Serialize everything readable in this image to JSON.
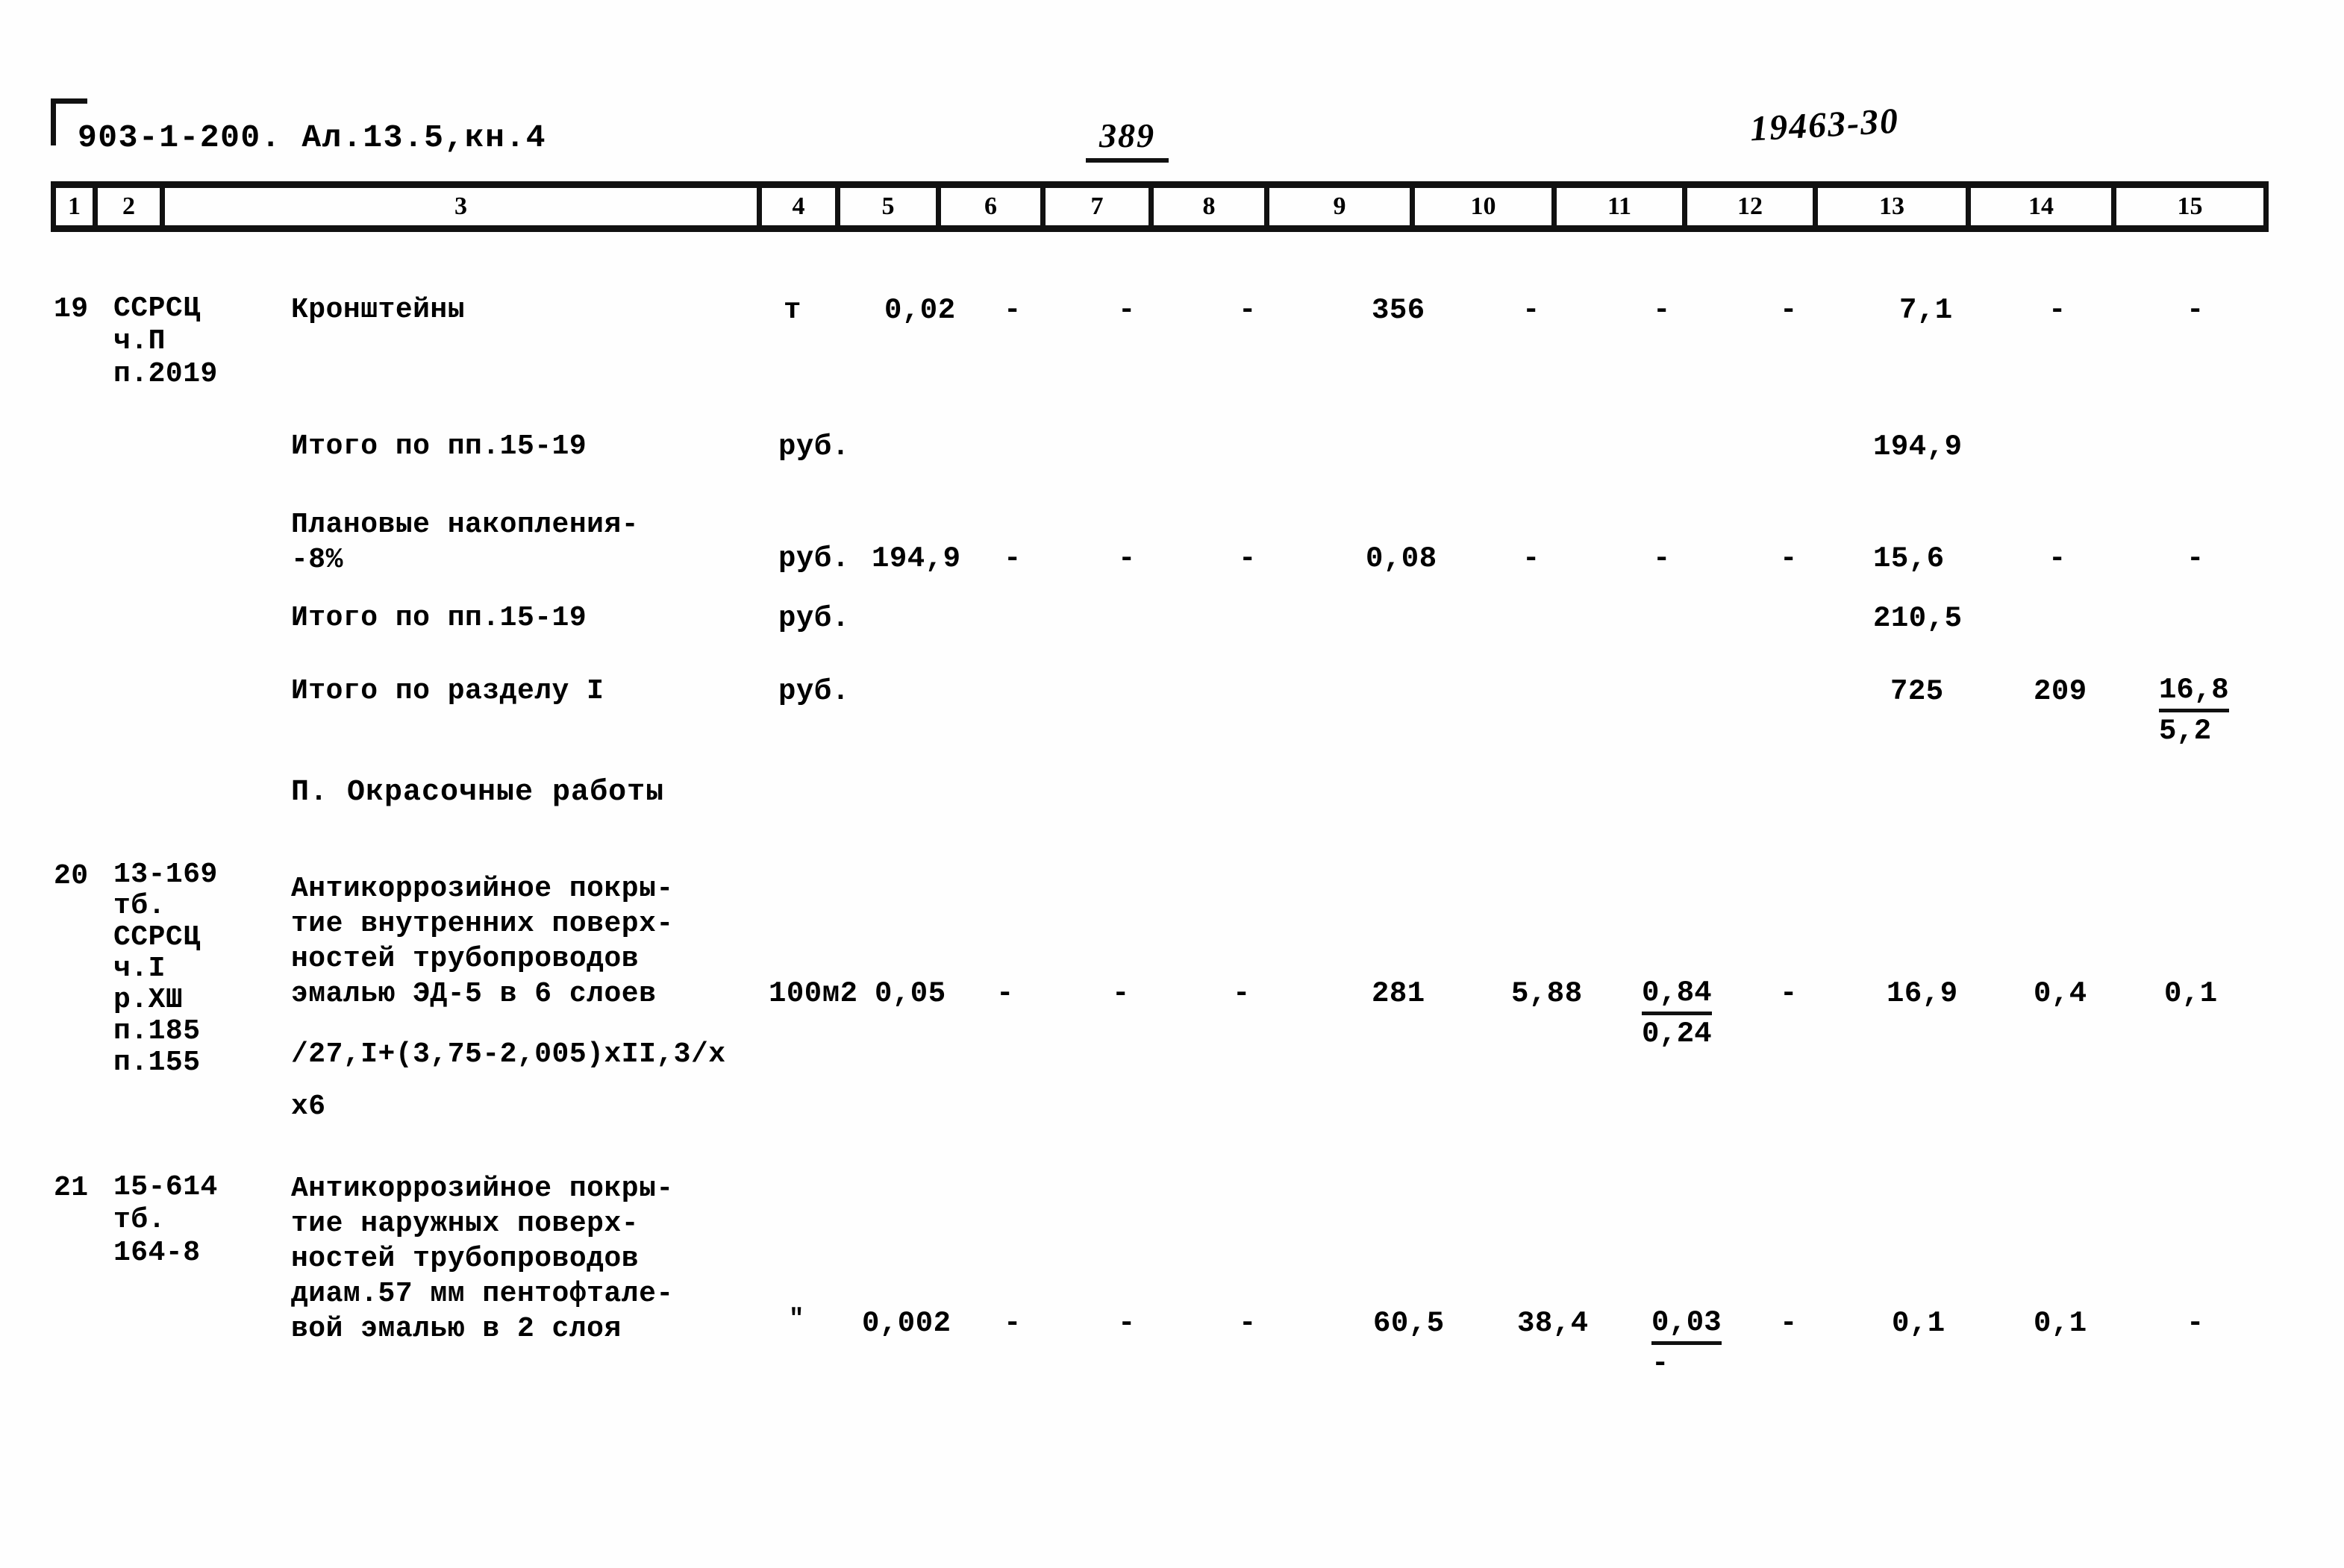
{
  "header": {
    "doc_code": "903-1-200. Ал.13.5,кн.4",
    "page_number": "389",
    "stamp_number": "19463-30"
  },
  "table": {
    "column_numbers": [
      "1",
      "2",
      "3",
      "4",
      "5",
      "6",
      "7",
      "8",
      "9",
      "10",
      "11",
      "12",
      "13",
      "14",
      "15"
    ],
    "rows": [
      {
        "id": "row-19",
        "col1": "19",
        "col2": "ССРСЦ\nч.П\nп.2019",
        "col3": "Кронштейны",
        "col4": "т",
        "col5": "0,02",
        "col6": "-",
        "col7": "-",
        "col8": "-",
        "col9": "356",
        "col10": "-",
        "col11": "-",
        "col12": "-",
        "col13": "7,1",
        "col14": "-",
        "col15": "-"
      },
      {
        "id": "row-itogo-1",
        "col3": "Итого по пп.15-19",
        "col4": "руб.",
        "col13": "194,9"
      },
      {
        "id": "row-planovye",
        "col3": "Плановые накопления-\n-8%",
        "col4": "руб.",
        "col5": "194,9",
        "col6": "-",
        "col7": "-",
        "col8": "-",
        "col9": "0,08",
        "col10": "-",
        "col11": "-",
        "col12": "-",
        "col13": "15,6",
        "col14": "-",
        "col15": "-"
      },
      {
        "id": "row-itogo-2",
        "col3": "Итого по пп.15-19",
        "col4": "руб.",
        "col13": "210,5"
      },
      {
        "id": "row-itogo-razdel",
        "col3": "Итого по разделу I",
        "col4": "руб.",
        "col13": "725",
        "col14": "209",
        "col15_top": "16,8",
        "col15_bot": "5,2"
      },
      {
        "id": "row-20",
        "col1": "20",
        "col2": "13-169\nтб.\nССРСЦ\nч.I\nр.ХШ\nп.185\nп.155",
        "col3": "Антикоррозийное покры-\nтие внутренних поверх-\nностей трубопроводов\nэмалью ЭД-5 в 6 слоев",
        "col3_extra": "/27,I+(3,75-2,005)хII,3/х",
        "col3_extra2": "х6",
        "col4": "100м2",
        "col5": "0,05",
        "col6": "-",
        "col7": "-",
        "col8": "-",
        "col9": "281",
        "col10": "5,88",
        "col11_top": "0,84",
        "col11_bot": "0,24",
        "col12": "-",
        "col13": "16,9",
        "col14": "0,4",
        "col15": "0,1"
      },
      {
        "id": "row-21",
        "col1": "21",
        "col2": "15-614\nтб.\n164-8",
        "col3": "Антикоррозийное покры-\nтие наружных поверх-\nностей трубопроводов\nдиам.57 мм пентофтале-\nвой эмалью в 2 слоя",
        "col4": "\"",
        "col5": "0,002",
        "col6": "-",
        "col7": "-",
        "col8": "-",
        "col9": "60,5",
        "col10": "38,4",
        "col11_top": "0,03",
        "col11_bot": "-",
        "col12": "-",
        "col13": "0,1",
        "col14": "0,1",
        "col15": "-"
      }
    ],
    "section_heading": "П. Окрасочные работы"
  }
}
